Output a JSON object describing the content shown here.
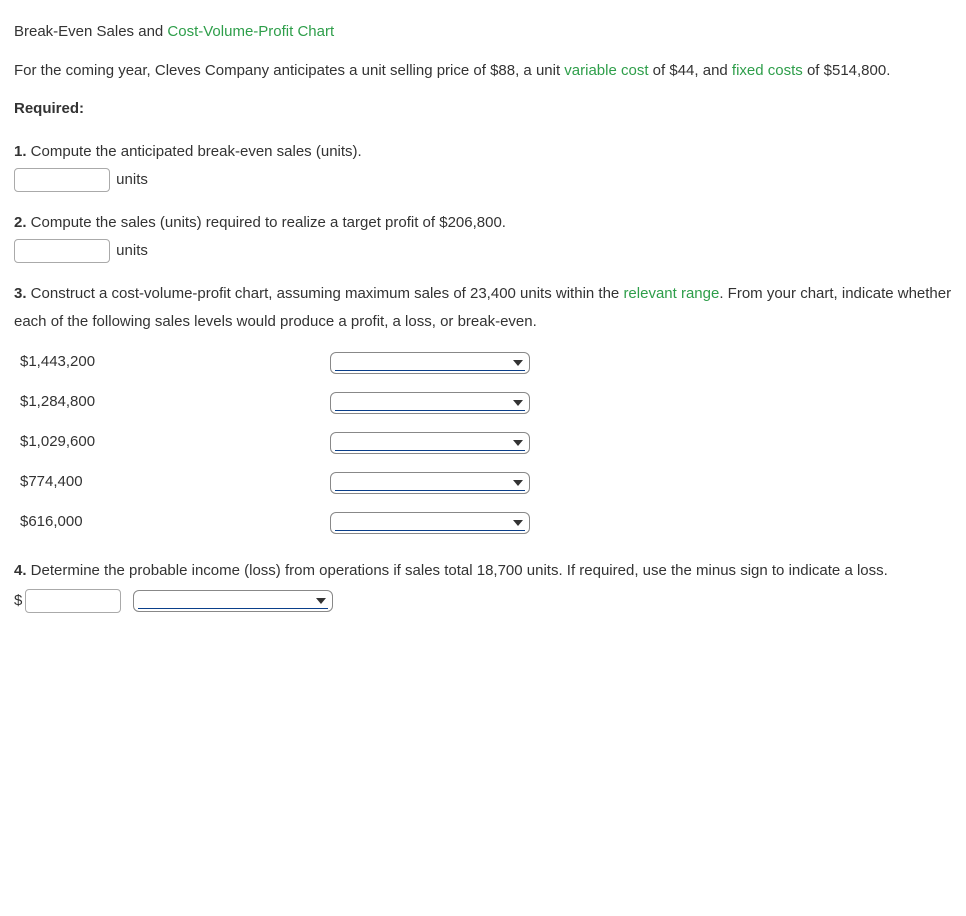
{
  "title": {
    "prefix": "Break-Even Sales and ",
    "link": "Cost-Volume-Profit Chart"
  },
  "intro": {
    "part1": "For the coming year, Cleves Company anticipates a unit selling price of $88, a unit ",
    "link1": "variable cost",
    "part2": " of $44, and ",
    "link2": "fixed costs",
    "part3": " of $514,800."
  },
  "required_label": "Required:",
  "q1": {
    "num": "1.",
    "text": " Compute the anticipated break-even sales (units).",
    "unit_label": "units"
  },
  "q2": {
    "num": "2.",
    "text": " Compute the sales (units) required to realize a target profit of $206,800.",
    "unit_label": "units"
  },
  "q3": {
    "num": "3.",
    "text1": " Construct a cost-volume-profit chart, assuming maximum sales of 23,400 units within the ",
    "link": "relevant range",
    "text2": ". From your chart, indicate whether each of the following sales levels would produce a profit, a loss, or break-even.",
    "rows": [
      {
        "label": "$1,443,200"
      },
      {
        "label": "$1,284,800"
      },
      {
        "label": "$1,029,600"
      },
      {
        "label": "$774,400"
      },
      {
        "label": "$616,000"
      }
    ]
  },
  "q4": {
    "num": "4.",
    "text": " Determine the probable income (loss) from operations if sales total 18,700 units. If required, use the minus sign to indicate a loss.",
    "currency": "$"
  }
}
